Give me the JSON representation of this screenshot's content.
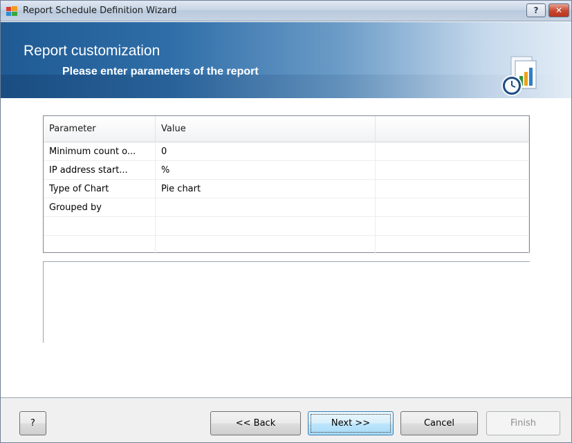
{
  "window": {
    "title": "Report Schedule Definition Wizard"
  },
  "titlebar": {
    "help_label": "?",
    "close_label": "✕"
  },
  "header": {
    "title": "Report customization",
    "subtitle": "Please enter parameters of the report"
  },
  "table": {
    "columns": [
      "Parameter",
      "Value",
      ""
    ],
    "rows": [
      {
        "parameter": "Minimum count o...",
        "value": "0"
      },
      {
        "parameter": "IP address start...",
        "value": "%"
      },
      {
        "parameter": "Type of Chart",
        "value": "Pie chart"
      },
      {
        "parameter": "Grouped by",
        "value": ""
      },
      {
        "parameter": "",
        "value": ""
      },
      {
        "parameter": "",
        "value": ""
      }
    ]
  },
  "buttons": {
    "help": "?",
    "back": "<< Back",
    "next": "Next >>",
    "cancel": "Cancel",
    "finish": "Finish"
  },
  "colors": {
    "banner_dark": "#1f5a93",
    "banner_light": "#e2ecf6",
    "close_red": "#c8442c"
  }
}
